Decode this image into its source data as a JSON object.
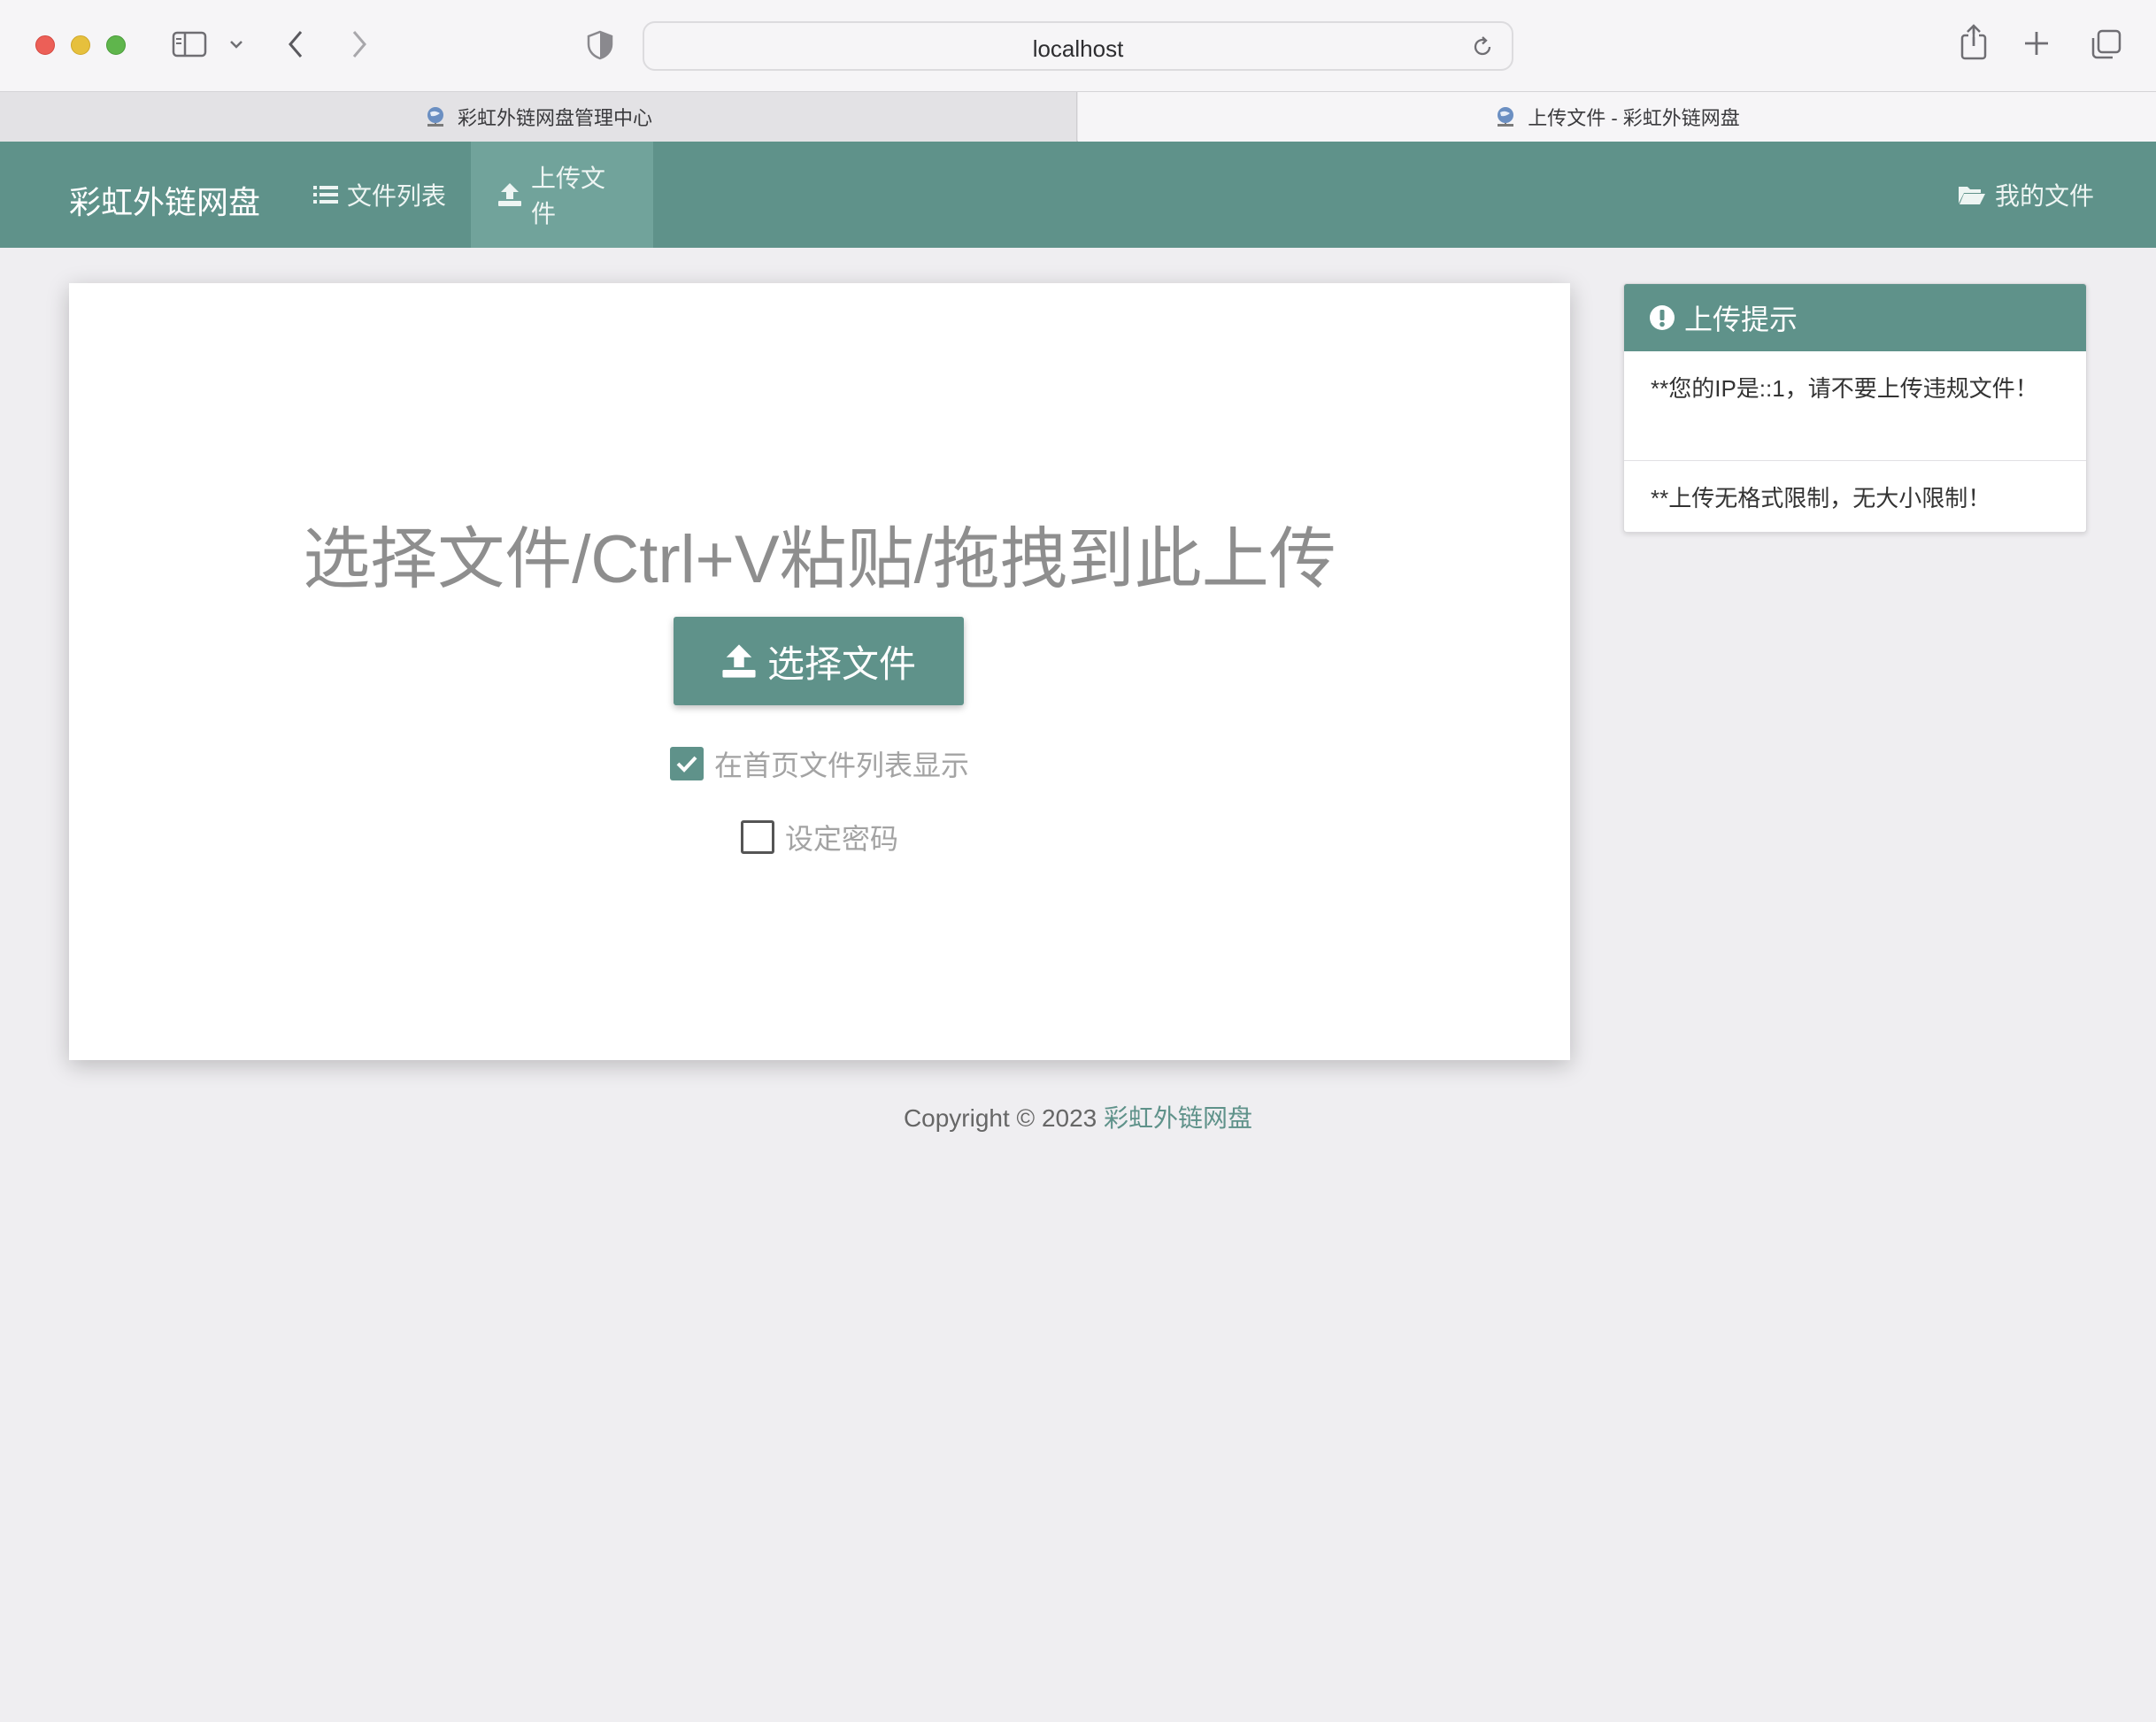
{
  "browser": {
    "url": "localhost",
    "tabs": [
      {
        "title": "彩虹外链网盘管理中心",
        "active": false
      },
      {
        "title": "上传文件 - 彩虹外链网盘",
        "active": true
      }
    ],
    "icons": [
      "sidebar-icon",
      "chevron-down-icon",
      "back-icon",
      "forward-icon",
      "shield-icon",
      "reload-icon",
      "share-icon",
      "new-tab-icon",
      "tab-overview-icon"
    ]
  },
  "navbar": {
    "brand": "彩虹外链网盘",
    "items": [
      {
        "label": "文件列表",
        "icon": "list-icon"
      },
      {
        "label": "上传文件",
        "icon": "upload-icon",
        "active": true
      },
      {
        "label": "我的文件",
        "icon": "folder-open-icon"
      }
    ]
  },
  "upload": {
    "title": "选择文件/Ctrl+V粘贴/拖拽到此上传",
    "button_label": "选择文件",
    "options": [
      {
        "label": "在首页文件列表显示",
        "checked": true
      },
      {
        "label": "设定密码",
        "checked": false
      }
    ]
  },
  "tips": {
    "title": "上传提示",
    "items": [
      "**您的IP是::1，请不要上传违规文件！",
      "**上传无格式限制，无大小限制！"
    ]
  },
  "footer": {
    "prefix": "Copyright © 2023 ",
    "site": "彩虹外链网盘"
  },
  "colors": {
    "accent": "#5f928a",
    "navbar_active": "#71a39b",
    "page_bg": "#efeef1"
  }
}
